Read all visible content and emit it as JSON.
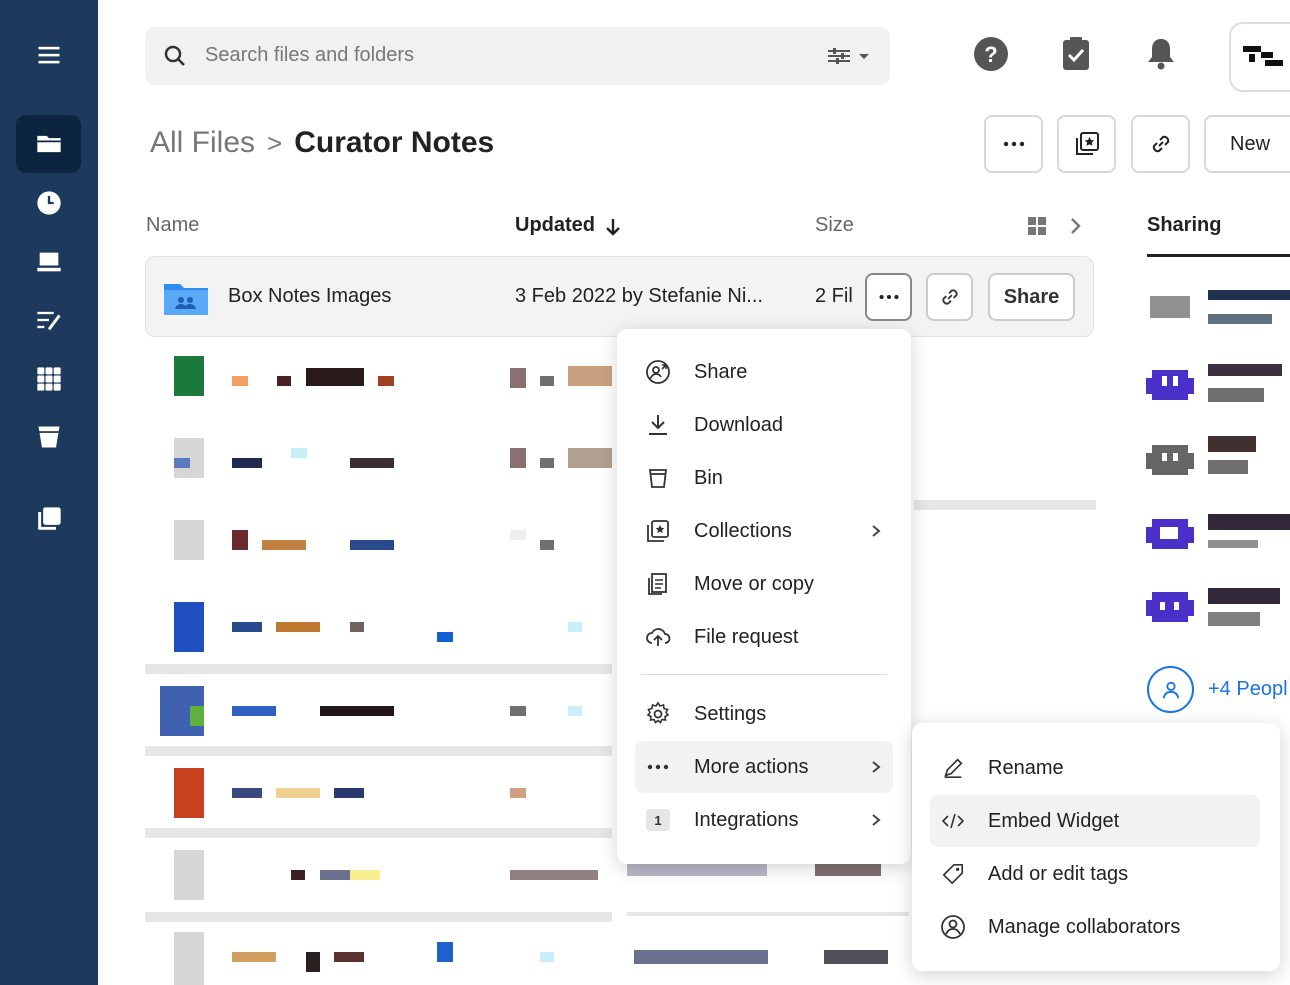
{
  "search": {
    "placeholder": "Search files and folders"
  },
  "breadcrumb": {
    "root": "All Files",
    "separator": ">",
    "current": "Curator Notes"
  },
  "header_buttons": {
    "more": "more-icon",
    "collections": "collections-icon",
    "link": "link-icon",
    "new_label": "New"
  },
  "columns": {
    "name": "Name",
    "updated": "Updated",
    "size": "Size"
  },
  "sharing": {
    "tab_label": "Sharing",
    "more_people": "+4 Peopl"
  },
  "selected_row": {
    "name": "Box Notes Images",
    "updated": "3 Feb 2022 by Stefanie Ni...",
    "size": "2 Fil",
    "share_label": "Share"
  },
  "context_menu": {
    "items": [
      {
        "label": "Share",
        "icon": "share-icon"
      },
      {
        "label": "Download",
        "icon": "download-icon"
      },
      {
        "label": "Bin",
        "icon": "bin-icon"
      },
      {
        "label": "Collections",
        "icon": "collections-icon"
      },
      {
        "label": "Move or copy",
        "icon": "move-copy-icon"
      },
      {
        "label": "File request",
        "icon": "file-request-icon"
      },
      {
        "label": "Settings",
        "icon": "settings-icon"
      },
      {
        "label": "More actions",
        "icon": "more-icon"
      },
      {
        "label": "Integrations",
        "icon": "integrations-badge",
        "badge": "1"
      }
    ]
  },
  "submenu": {
    "items": [
      {
        "label": "Rename",
        "icon": "pencil-icon"
      },
      {
        "label": "Embed Widget",
        "icon": "code-icon"
      },
      {
        "label": "Add or edit tags",
        "icon": "tag-icon"
      },
      {
        "label": "Manage collaborators",
        "icon": "user-circle-icon"
      }
    ]
  },
  "colors": {
    "sidebar": "#1d3a5c",
    "sidebar_active": "#0d2440",
    "accent": "#1a73e8",
    "avatar": "#4b2fc9"
  }
}
